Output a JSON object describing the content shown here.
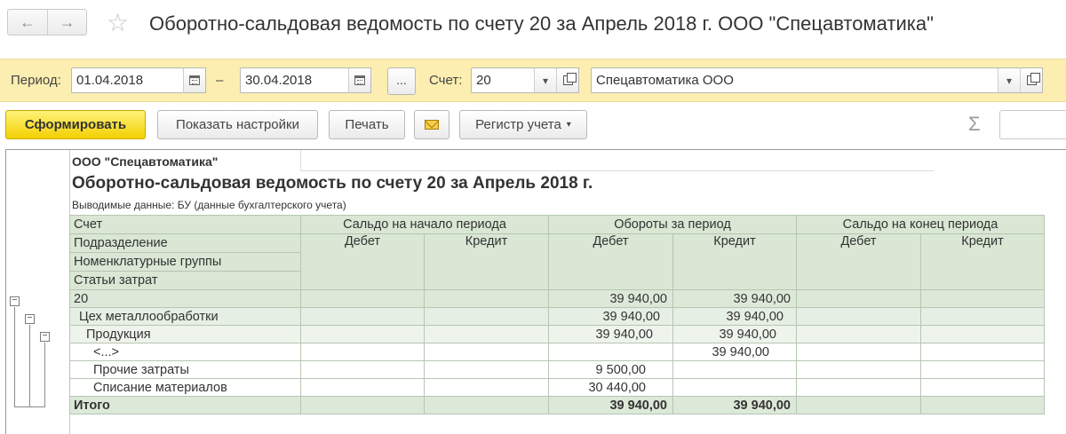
{
  "window": {
    "title": "Оборотно-сальдовая ведомость по счету 20 за Апрель 2018 г. ООО \"Спецавтоматика\"",
    "back_icon": "arrow-left-icon",
    "forward_icon": "arrow-right-icon",
    "favorite_icon": "star-icon"
  },
  "filters": {
    "period_label": "Период:",
    "date_from": "01.04.2018",
    "dash": "–",
    "date_to": "30.04.2018",
    "choose_period": "...",
    "account_label": "Счет:",
    "account_value": "20",
    "organization_value": "Спецавтоматика ООО"
  },
  "toolbar": {
    "generate": "Сформировать",
    "show_settings": "Показать настройки",
    "print": "Печать",
    "register": "Регистр учета",
    "sum_symbol": "Σ"
  },
  "report": {
    "organization": "ООО \"Спецавтоматика\"",
    "title": "Оборотно-сальдовая ведомость по счету 20 за Апрель 2018 г.",
    "output_data": "Выводимые данные:  БУ (данные бухгалтерского учета)",
    "headers": {
      "account": "Счет",
      "department": "Подразделение",
      "nomenclature_groups": "Номенклатурные группы",
      "cost_items": "Статьи затрат",
      "opening_balance": "Сальдо на начало периода",
      "turnover": "Обороты за период",
      "closing_balance": "Сальдо на конец периода",
      "debit": "Дебет",
      "credit": "Кредит"
    },
    "rows": [
      {
        "name": "20",
        "ob_d": "",
        "ob_c": "",
        "t_d": "39 940,00",
        "t_c": "39 940,00",
        "cb_d": "",
        "cb_c": ""
      },
      {
        "name": "Цех металлообработки",
        "ob_d": "",
        "ob_c": "",
        "t_d": "39 940,00",
        "t_c": "39 940,00",
        "cb_d": "",
        "cb_c": ""
      },
      {
        "name": "Продукция",
        "ob_d": "",
        "ob_c": "",
        "t_d": "39 940,00",
        "t_c": "39 940,00",
        "cb_d": "",
        "cb_c": ""
      },
      {
        "name": "<...>",
        "ob_d": "",
        "ob_c": "",
        "t_d": "",
        "t_c": "39 940,00",
        "cb_d": "",
        "cb_c": ""
      },
      {
        "name": "Прочие затраты",
        "ob_d": "",
        "ob_c": "",
        "t_d": "9 500,00",
        "t_c": "",
        "cb_d": "",
        "cb_c": ""
      },
      {
        "name": "Списание материалов",
        "ob_d": "",
        "ob_c": "",
        "t_d": "30 440,00",
        "t_c": "",
        "cb_d": "",
        "cb_c": ""
      }
    ],
    "total": {
      "name": "Итого",
      "ob_d": "",
      "ob_c": "",
      "t_d": "39 940,00",
      "t_c": "39 940,00",
      "cb_d": "",
      "cb_c": ""
    }
  },
  "colors": {
    "filter_bar": "#fbeeb0",
    "primary_button": "#f2d000",
    "header_green": "#d9e7d4"
  }
}
